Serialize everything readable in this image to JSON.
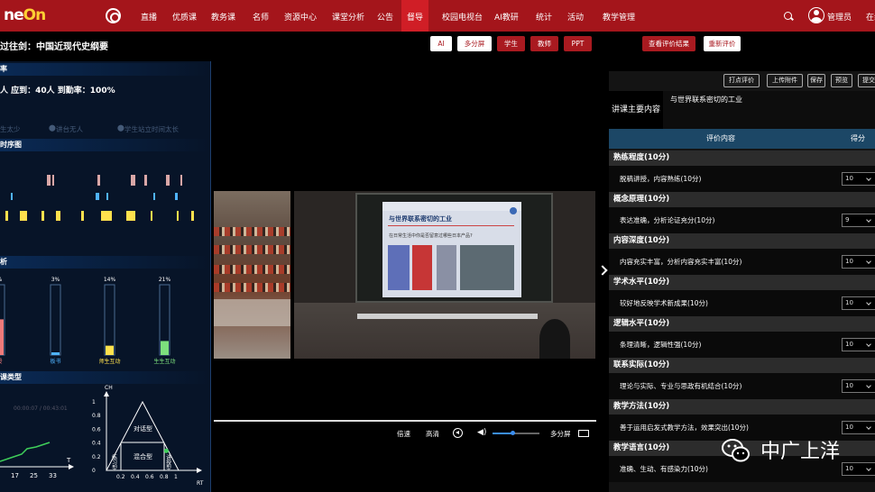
{
  "nav": {
    "logo_a": "ne",
    "logo_b": "On",
    "items": [
      "直播",
      "优质课",
      "教务课",
      "名师",
      "资源中心",
      "课堂分析",
      "公告",
      "督导",
      "校园电视台",
      "AI教研",
      "统计",
      "活动",
      "教学管理"
    ],
    "active_index": 7,
    "user": "管理员",
    "user_extra": "在线"
  },
  "toolbar": {
    "title": "过往剑：中国近现代史纲要",
    "buttons": [
      "AI",
      "多分屏",
      "学生",
      "教师",
      "PPT"
    ],
    "view_result": "查看评价结果",
    "re_evaluate": "重新评价"
  },
  "left_panel": {
    "head1": "率",
    "stats": "人   应到：40人   到勤率：100%",
    "dim_items": [
      "生太少",
      "讲台无人",
      "学生站立时间太长"
    ],
    "head2": "时序图",
    "head3": "析",
    "bars": [
      {
        "pct": "%",
        "value": 0.35,
        "label": "授",
        "color": "#f07a7a"
      },
      {
        "pct": "3%",
        "value": 0.03,
        "label": "板书",
        "color": "#4fb3ff"
      },
      {
        "pct": "14%",
        "value": 0.14,
        "label": "师生互动",
        "color": "#ffe14d"
      },
      {
        "pct": "21%",
        "value": 0.21,
        "label": "生生互动",
        "color": "#7de07d"
      }
    ],
    "head4": "课类型",
    "time_readout": "00:00:07 / 00:43:01",
    "rt_chart": {
      "y_axis": "CH",
      "x_axis": "RT",
      "y_ticks": [
        "1",
        "0.8",
        "0.6",
        "0.4",
        "0.2",
        "0"
      ],
      "x_ticks": [
        "0.2",
        "0.4",
        "0.6",
        "0.8",
        "1"
      ],
      "regions": [
        "对话型",
        "混合型",
        "练习型",
        "讲授型"
      ],
      "point": {
        "rt": 0.58,
        "ch": 0.18
      }
    },
    "st_chart": {
      "x_ticks": [
        "17",
        "25",
        "33"
      ],
      "x_axis": "T"
    }
  },
  "video": {
    "slide_title": "与世界联系密切的工业",
    "slide_sub": "在日常生活中你是否留意过哪些日本产品?",
    "controls": [
      "倍速",
      "高清",
      "多分屏"
    ]
  },
  "right_panel": {
    "buttons": [
      "打点评价",
      "上传附件",
      "保存",
      "预览",
      "提交"
    ],
    "lecture_label": "讲课主要内容",
    "lecture_content": "与世界联系密切的工业",
    "table_head_content": "评价内容",
    "table_head_score": "得分",
    "criteria": [
      {
        "category": "熟练程度(10分)",
        "item": "脱稿讲授，内容熟练(10分)",
        "score": "10"
      },
      {
        "category": "概念原理(10分)",
        "item": "表达准确，分析论证充分(10分)",
        "score": "9"
      },
      {
        "category": "内容深度(10分)",
        "item": "内容充实丰富，分析内容充实丰富(10分)",
        "score": "10"
      },
      {
        "category": "学术水平(10分)",
        "item": "较好地反映学术新成果(10分)",
        "score": "10"
      },
      {
        "category": "逻辑水平(10分)",
        "item": "条理清晰，逻辑性强(10分)",
        "score": "10"
      },
      {
        "category": "联系实际(10分)",
        "item": "理论与实际、专业与思政有机结合(10分)",
        "score": "10"
      },
      {
        "category": "教学方法(10分)",
        "item": "善于运用启发式教学方法，效果突出(10分)",
        "score": "10"
      },
      {
        "category": "教学语言(10分)",
        "item": "准确、生动、有感染力(10分)",
        "score": "10"
      }
    ]
  },
  "watermark": "中广上洋",
  "colors": {
    "brand_red": "#a4151b",
    "active_red": "#d01e26",
    "panel_blue": "#071428",
    "table_head": "#1c4766"
  }
}
